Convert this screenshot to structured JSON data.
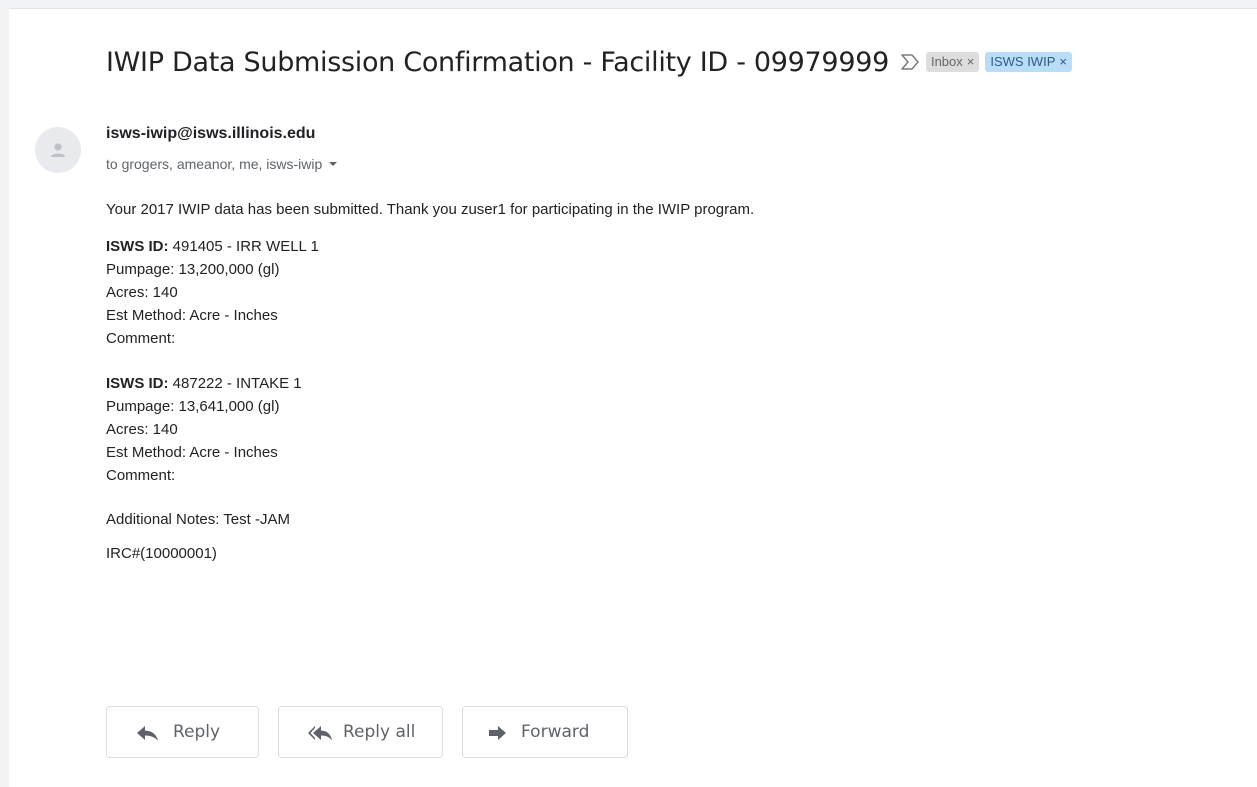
{
  "email": {
    "subject": "IWIP Data Submission Confirmation - Facility ID - 09979999",
    "labels": [
      {
        "text": "Inbox",
        "close": "×"
      },
      {
        "text": "ISWS IWIP",
        "close": "×"
      }
    ],
    "sender": "isws-iwip@isws.illinois.edu",
    "recipients": "to grogers, ameanor, me, isws-iwip",
    "intro": "Your 2017 IWIP data has been submitted. Thank you zuser1 for participating in the IWIP program.",
    "records": [
      {
        "id_label": "ISWS ID:",
        "id_value": "491405 - IRR WELL 1",
        "pumpage": "Pumpage: 13,200,000 (gl)",
        "acres": "Acres: 140",
        "method": "Est Method: Acre - Inches",
        "comment": "Comment:"
      },
      {
        "id_label": "ISWS ID:",
        "id_value": "487222 - INTAKE 1",
        "pumpage": "Pumpage: 13,641,000 (gl)",
        "acres": "Acres: 140",
        "method": "Est Method: Acre - Inches",
        "comment": "Comment:"
      }
    ],
    "notes": "Additional Notes: Test -JAM",
    "irc": "IRC#(10000001)"
  },
  "actions": {
    "reply": "Reply",
    "reply_all": "Reply all",
    "forward": "Forward"
  },
  "icons": {
    "important": "important-marker-icon",
    "avatar": "person-icon",
    "recipients_toggle": "caret-down-icon",
    "reply": "reply-arrow-icon",
    "reply_all": "reply-all-arrow-icon",
    "forward": "forward-arrow-icon"
  },
  "colors": {
    "iwip_label_bg": "#b9dcf7",
    "inbox_label_bg": "#dddddd"
  }
}
